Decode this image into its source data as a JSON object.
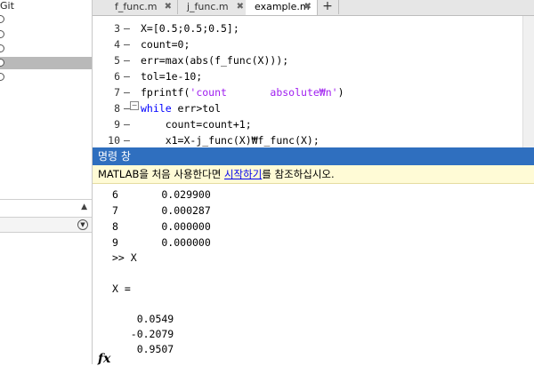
{
  "left_panel": {
    "header": "Git",
    "files": [
      {
        "id": "f1",
        "selected": false
      },
      {
        "id": "f2",
        "selected": false
      },
      {
        "id": "f3",
        "selected": false
      },
      {
        "id": "f4",
        "selected": true
      },
      {
        "id": "f5",
        "selected": false
      }
    ]
  },
  "editor": {
    "tabs": [
      {
        "label": "f_func.m",
        "close": "✖"
      },
      {
        "label": "j_func.m",
        "close": "✖"
      },
      {
        "label": "example.m",
        "close": "✖"
      }
    ],
    "add_tab": "+",
    "lines": [
      {
        "num": "3",
        "text": "X=[0.5;0.5;0.5];"
      },
      {
        "num": "4",
        "text": "count=0;"
      },
      {
        "num": "5",
        "text": "err=max(abs(f_func(X)));"
      },
      {
        "num": "6",
        "text": "tol=1e-10;"
      },
      {
        "num": "7",
        "pre": "fprintf(",
        "str": "'count       absolute₩n'",
        "post": ")"
      },
      {
        "num": "8",
        "kw": "while",
        "post": " err>tol"
      },
      {
        "num": "9",
        "text": "    count=count+1;"
      },
      {
        "num": "10",
        "text": "    x1=X-j_func(X)₩f_func(X);"
      }
    ]
  },
  "command_window": {
    "title": "명령 창",
    "notice_pre": "MATLAB을 처음 사용한다면 ",
    "notice_link": "시작하기",
    "notice_post": "를 참조하십시오.",
    "output": [
      "6       0.029900",
      "7       0.000287",
      "8       0.000000",
      "9       0.000000",
      ">> X",
      "",
      "X =",
      "",
      "    0.0549",
      "   -0.2079",
      "    0.9507"
    ],
    "fx": "fx"
  }
}
